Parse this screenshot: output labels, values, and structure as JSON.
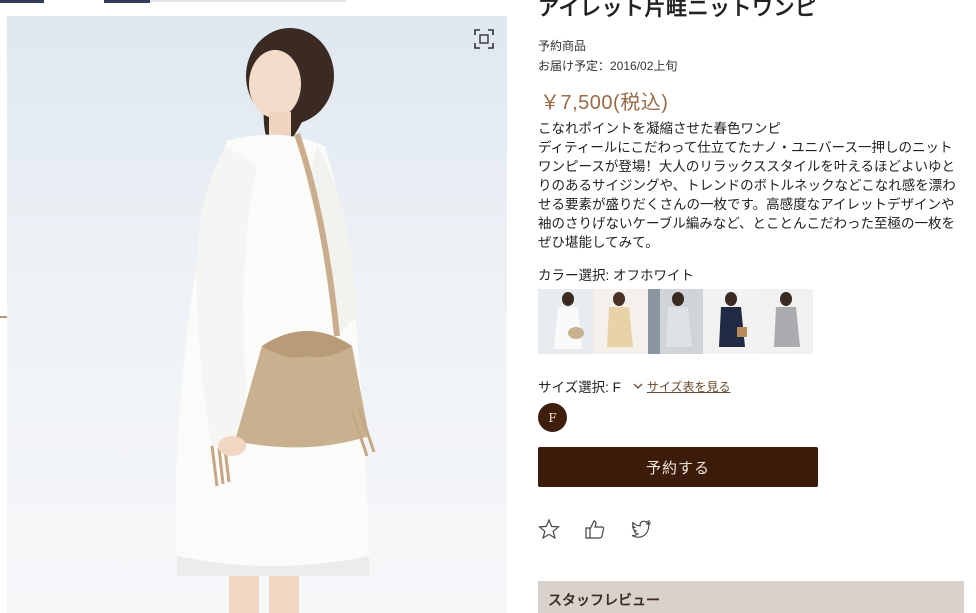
{
  "product": {
    "title": "アイレット片畦ニットワンピ",
    "tag": "予約商品",
    "delivery": "お届け予定：2016/02上旬",
    "price": "￥7,500(税込)",
    "description": [
      "こなれポイントを凝縮させた春色ワンピ",
      "ディティールにこだわって仕立てたナノ・ユニバース一押しのニットワンピースが登場！大人のリラックススタイルを叶えるほどよいゆとりのあるサイジングや、トレンドのボトルネックなどこなれ感を漂わせる要素が盛りだくさんの一枚です。高感度なアイレットデザインや袖のさりげないケーブル編みなど、とことんこだわった至極の一枚をぜひ堪能してみて。"
    ]
  },
  "color": {
    "label": "カラー選択: オフホワイト",
    "swatches": [
      "offwhite-swatch",
      "beige-swatch",
      "lightgray-swatch",
      "navy-swatch",
      "gray-swatch"
    ]
  },
  "size": {
    "label": "サイズ選択: F",
    "guide_link": "サイズ表を見る",
    "chip": "F"
  },
  "buttons": {
    "reserve": "予約する"
  },
  "icons": [
    "star-icon",
    "thumbs-up-icon",
    "twitter-icon",
    "zoom-icon",
    "chevron-down-icon"
  ],
  "colors": {
    "accent_dark": "#3b1c0b",
    "price": "#9a6a46",
    "review_bg": "#d9d1cc"
  },
  "staff_review": {
    "heading": "スタッフレビュー"
  }
}
